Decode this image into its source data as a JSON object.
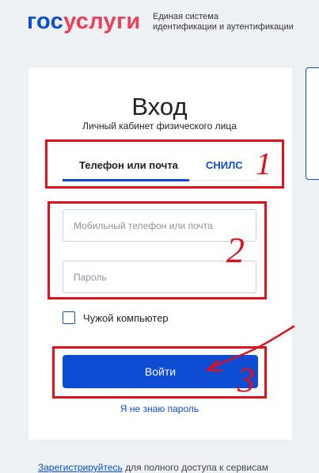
{
  "header": {
    "logo_part1": "гос",
    "logo_part2": "услуги",
    "system_line1": "Единая система",
    "system_line2": "идентификации и аутентификации"
  },
  "login": {
    "title": "Вход",
    "subtitle": "Личный кабинет физического лица",
    "tabs": [
      {
        "label": "Телефон или почта",
        "active": true
      },
      {
        "label": "СНИЛС",
        "active": false
      }
    ],
    "login_placeholder": "Мобильный телефон или почта",
    "login_value": "",
    "password_placeholder": "Пароль",
    "password_value": "",
    "foreign_computer_label": "Чужой компьютер",
    "foreign_computer_checked": false,
    "submit_label": "Войти",
    "forgot_password_label": "Я не знаю пароль"
  },
  "footer": {
    "register_link": "Зарегистрируйтесь",
    "register_text": " для полного доступа к сервисам"
  },
  "annotations": {
    "number_1": "1",
    "number_2": "2",
    "number_3": "3"
  },
  "colors": {
    "brand_blue": "#0d4cd3",
    "brand_red": "#ee3f58",
    "annotation_red": "#e0101c",
    "background": "#eef1f4"
  }
}
